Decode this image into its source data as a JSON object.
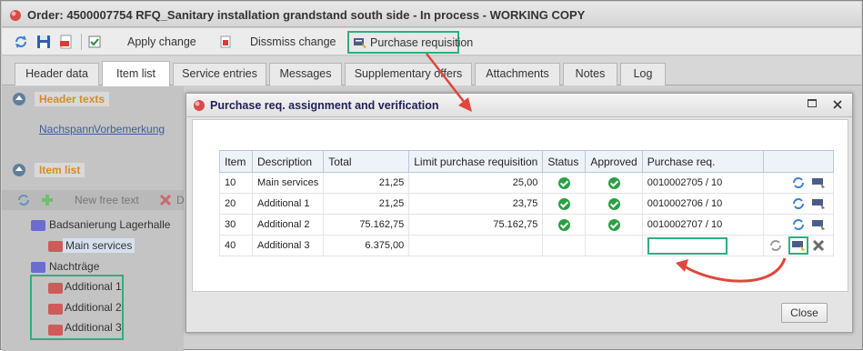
{
  "window": {
    "title": "Order: 4500007754 RFQ_Sanitary installation grandstand south side - In process - WORKING COPY"
  },
  "toolbar": {
    "apply_change": "Apply change",
    "dismiss_change": "Dissmiss change",
    "purchase_requisition": "Purchase requisition"
  },
  "tabs": [
    {
      "label": "Header data"
    },
    {
      "label": "Item list"
    },
    {
      "label": "Service entries"
    },
    {
      "label": "Messages"
    },
    {
      "label": "Supplementary offers"
    },
    {
      "label": "Attachments"
    },
    {
      "label": "Notes"
    },
    {
      "label": "Log"
    }
  ],
  "left_panel": {
    "header_texts_label": "Header texts",
    "link_nachspann": "Nachspann",
    "link_vorbemerkung": "Vorbemerkung",
    "item_list_label": "Item list",
    "new_free_text": "New free text",
    "truncated_d": "D",
    "tree": {
      "root1": "Badsanierung Lagerhalle",
      "main_services": "Main services",
      "root2": "Nachträge",
      "additional1": "Additional 1",
      "additional2": "Additional 2",
      "additional3": "Additional 3"
    }
  },
  "dialog": {
    "title": "Purchase req. assignment and verification",
    "close_label": "Close",
    "columns": [
      "Item",
      "Description",
      "Total",
      "Limit purchase requisition",
      "Status",
      "Approved",
      "Purchase req."
    ],
    "rows": [
      {
        "item": "10",
        "description": "Main services",
        "total": "21,25",
        "limit": "25,00",
        "status": "ok",
        "approved": "ok",
        "pr": "0010002705 / 10"
      },
      {
        "item": "20",
        "description": "Additional 1",
        "total": "21,25",
        "limit": "23,75",
        "status": "ok",
        "approved": "ok",
        "pr": "0010002706 / 10"
      },
      {
        "item": "30",
        "description": "Additional 2",
        "total": "75.162,75",
        "limit": "75.162,75",
        "status": "ok",
        "approved": "ok",
        "pr": "0010002707 / 10"
      },
      {
        "item": "40",
        "description": "Additional 3",
        "total": "6.375,00",
        "limit": "",
        "status": "",
        "approved": "",
        "pr": ""
      }
    ]
  },
  "colors": {
    "highlight": "#2bb07f",
    "annotation_arrow": "#e0463c",
    "status_ok": "#2aa044"
  }
}
